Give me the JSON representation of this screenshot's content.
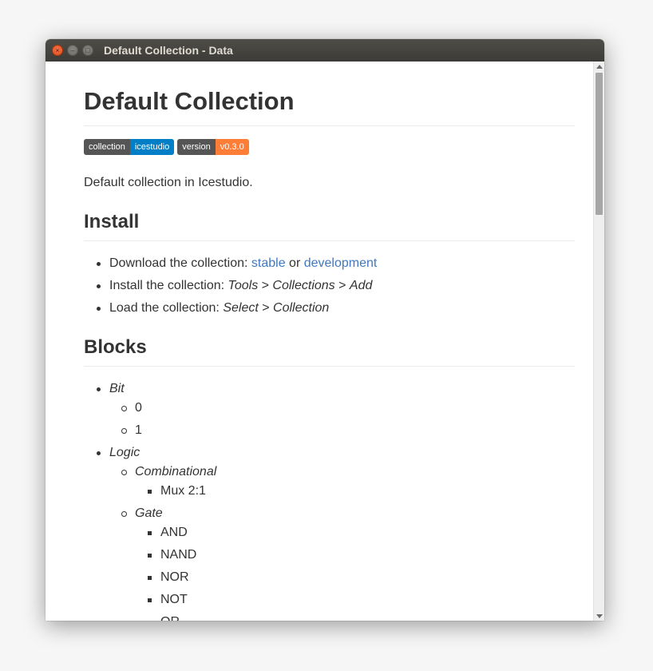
{
  "window": {
    "title": "Default Collection - Data",
    "close_glyph": "×",
    "min_glyph": "–",
    "max_glyph": "□"
  },
  "doc": {
    "title": "Default Collection",
    "badges": [
      {
        "label": "collection",
        "value": "icestudio",
        "color": "#007ec6"
      },
      {
        "label": "version",
        "value": "v0.3.0",
        "color": "#fe7d37"
      }
    ],
    "description": "Default collection in Icestudio.",
    "install": {
      "heading": "Install",
      "items": [
        {
          "prefix": "Download the collection: ",
          "link1": "stable",
          "mid": " or ",
          "link2": "development"
        },
        {
          "prefix": "Install the collection: ",
          "a": "Tools",
          "sep1": " > ",
          "b": "Collections",
          "sep2": " > ",
          "c": "Add"
        },
        {
          "prefix": "Load the collection: ",
          "a": "Select",
          "sep1": " > ",
          "b": "Collection"
        }
      ]
    },
    "blocks": {
      "heading": "Blocks",
      "bit": {
        "label": "Bit",
        "items": [
          "0",
          "1"
        ]
      },
      "logic": {
        "label": "Logic",
        "combinational": {
          "label": "Combinational",
          "items": [
            "Mux 2:1"
          ]
        },
        "gate": {
          "label": "Gate",
          "items": [
            "AND",
            "NAND",
            "NOR",
            "NOT",
            "OR"
          ]
        }
      }
    }
  },
  "colors": {
    "link": "#4078c0",
    "titlebar": "#3c3b37",
    "close_button": "#df4b16"
  }
}
